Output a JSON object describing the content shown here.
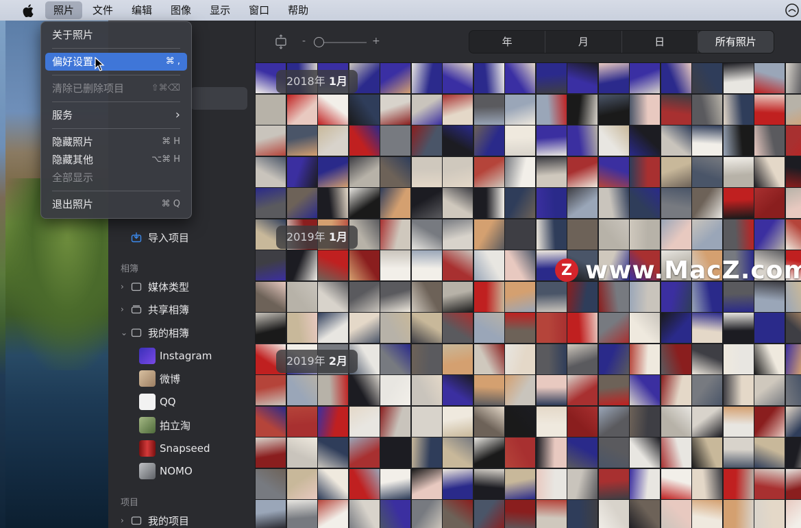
{
  "menubar": {
    "apple_icon": "apple-logo-icon",
    "items": [
      "照片",
      "文件",
      "编辑",
      "图像",
      "显示",
      "窗口",
      "帮助"
    ],
    "active_index": 0,
    "right_icon": "control-center-icon"
  },
  "dropdown": {
    "items": [
      {
        "label": "关于照片",
        "shortcut": ""
      },
      {
        "label": "偏好设置...",
        "shortcut": "⌘ ,",
        "highlighted": true
      },
      {
        "label": "清除已删除项目",
        "shortcut": "⇧⌘⌫",
        "disabled": true
      },
      {
        "label": "服务",
        "shortcut": "›"
      },
      {
        "label": "隐藏照片",
        "shortcut": "⌘ H"
      },
      {
        "label": "隐藏其他",
        "shortcut": "⌥⌘ H"
      },
      {
        "label": "全部显示",
        "shortcut": "",
        "disabled": true
      },
      {
        "label": "退出照片",
        "shortcut": "⌘ Q"
      }
    ]
  },
  "sidebar": {
    "import_label": "导入项目",
    "albums_header": "相簿",
    "groups": [
      {
        "label": "媒体类型"
      },
      {
        "label": "共享相簿"
      },
      {
        "label": "我的相簿"
      }
    ],
    "albums": [
      {
        "label": "Instagram",
        "color": "#5a3fd6"
      },
      {
        "label": "微博",
        "color": "#c9a98a"
      },
      {
        "label": "QQ",
        "color": "#f0f0f0"
      },
      {
        "label": "拍立淘",
        "color": "#7a9a5a"
      },
      {
        "label": "Snapseed",
        "color": "#c02a2a"
      },
      {
        "label": "NOMO",
        "color": "#8a8d92"
      }
    ],
    "projects_header": "项目",
    "projects": [
      {
        "label": "我的项目"
      }
    ]
  },
  "toolbar": {
    "zoom_minus": "-",
    "zoom_plus": "+",
    "zoom_level": 0.1,
    "segments": [
      "年",
      "月",
      "日",
      "所有照片"
    ],
    "active_segment": 3
  },
  "grid": {
    "sections": [
      {
        "year": "2018年",
        "month": "1月"
      },
      {
        "year": "2019年",
        "month": "1月"
      },
      {
        "year": "2019年",
        "month": "2月"
      }
    ]
  },
  "watermark": {
    "badge": "Z",
    "text": "www.MacZ.com"
  }
}
